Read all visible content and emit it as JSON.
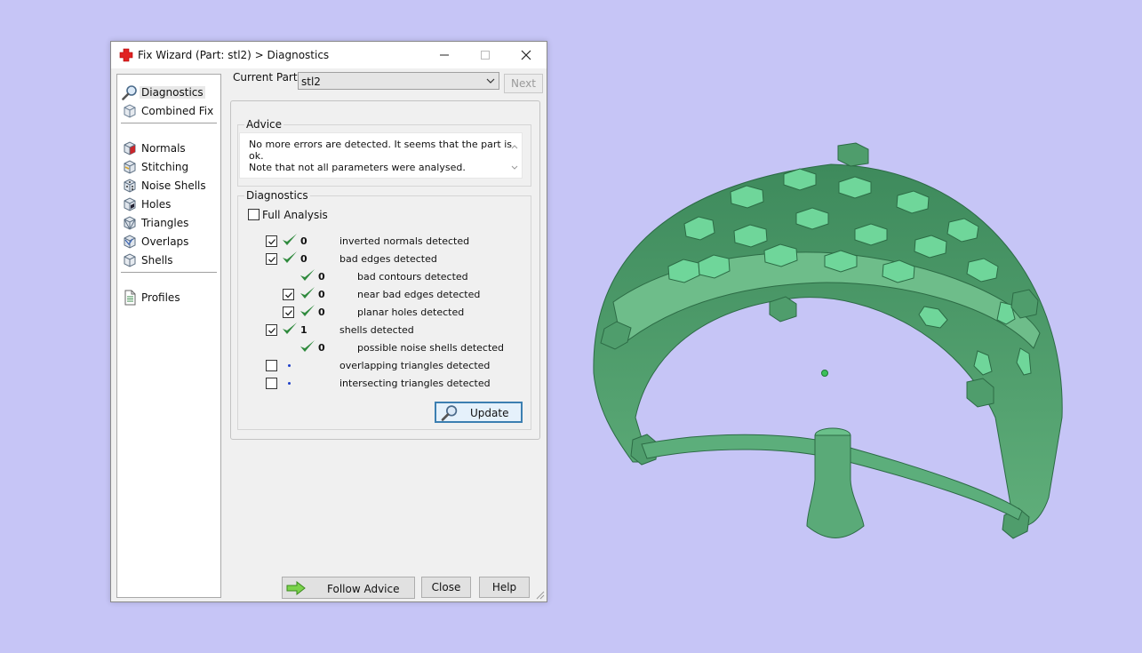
{
  "window": {
    "title": "Fix Wizard (Part: stl2) > Diagnostics"
  },
  "nav": {
    "items": [
      {
        "label": "Diagnostics",
        "icon": "magnifier-icon",
        "selected": true
      },
      {
        "label": "Combined Fix",
        "icon": "cube-icon"
      },
      {
        "label": "Normals",
        "icon": "normals-cube-icon"
      },
      {
        "label": "Stitching",
        "icon": "stitching-cube-icon"
      },
      {
        "label": "Noise Shells",
        "icon": "noise-shells-cube-icon"
      },
      {
        "label": "Holes",
        "icon": "holes-cube-icon"
      },
      {
        "label": "Triangles",
        "icon": "triangles-cube-icon"
      },
      {
        "label": "Overlaps",
        "icon": "overlaps-cube-icon"
      },
      {
        "label": "Shells",
        "icon": "shells-cube-icon"
      },
      {
        "label": "Profiles",
        "icon": "document-icon"
      }
    ]
  },
  "header": {
    "current_part_label": "Current Part:",
    "current_part_value": "stl2",
    "next_label": "Next"
  },
  "advice": {
    "title": "Advice",
    "text": "No more errors are detected. It seems that the part is ok.\nNote that not all parameters were analysed."
  },
  "diagnostics": {
    "title": "Diagnostics",
    "full_analysis_label": "Full Analysis",
    "full_analysis_checked": false,
    "rows": [
      {
        "checkbox": true,
        "checked": true,
        "status": "ok",
        "count": "0",
        "label": "inverted normals detected"
      },
      {
        "checkbox": true,
        "checked": true,
        "status": "ok",
        "count": "0",
        "label": "bad edges detected"
      },
      {
        "checkbox": false,
        "checked": false,
        "status": "ok",
        "count": "0",
        "label": "bad contours detected"
      },
      {
        "checkbox": true,
        "checked": true,
        "status": "ok",
        "count": "0",
        "label": "near bad edges detected"
      },
      {
        "checkbox": true,
        "checked": true,
        "status": "ok",
        "count": "0",
        "label": "planar holes detected"
      },
      {
        "checkbox": true,
        "checked": true,
        "status": "ok",
        "count": "1",
        "label": "shells detected"
      },
      {
        "checkbox": false,
        "checked": false,
        "status": "ok",
        "count": "0",
        "label": "possible noise shells detected"
      },
      {
        "checkbox": true,
        "checked": false,
        "status": "pending",
        "count": "",
        "label": "overlapping triangles detected"
      },
      {
        "checkbox": true,
        "checked": false,
        "status": "pending",
        "count": "",
        "label": "intersecting triangles detected"
      }
    ],
    "update_label": "Update"
  },
  "footer": {
    "follow_advice_label": "Follow Advice",
    "close_label": "Close",
    "help_label": "Help"
  },
  "colors": {
    "background": "#c6c5f6",
    "model_green": "#4f9d6c",
    "ok_green": "#2f8a3d",
    "pending_blue": "#1e3ec8"
  }
}
